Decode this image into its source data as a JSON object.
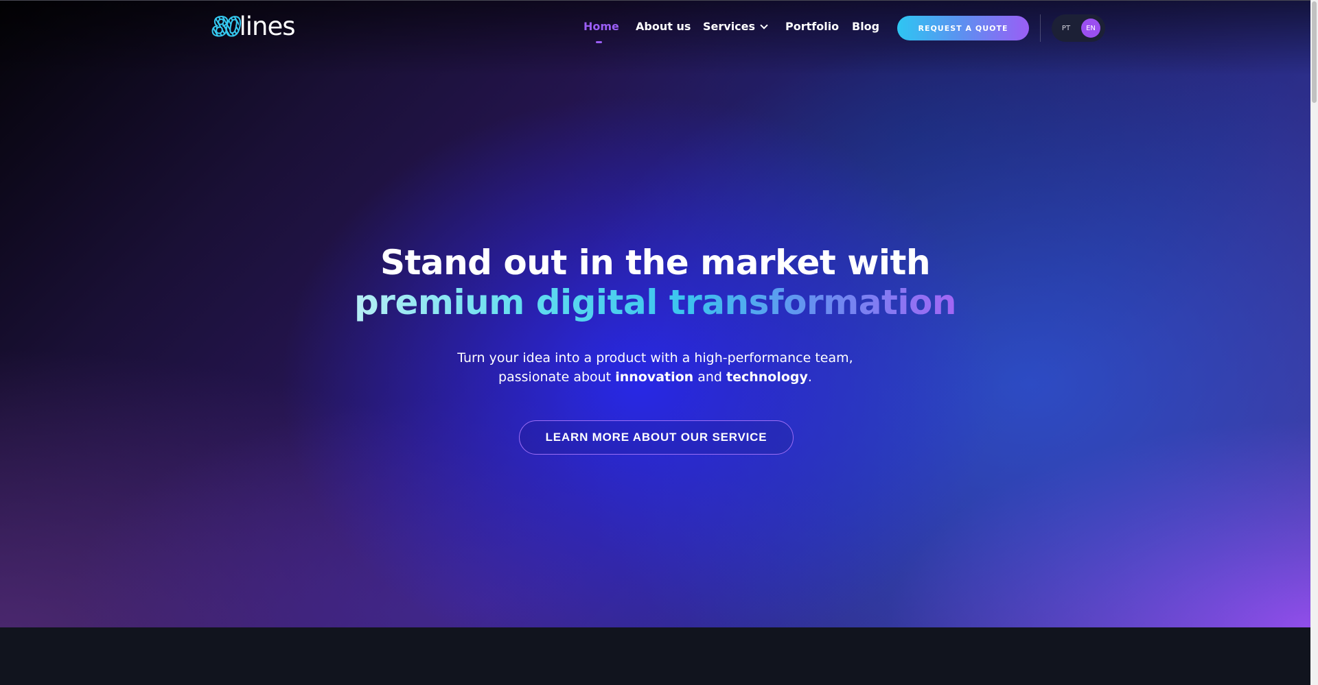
{
  "brand": {
    "logo_mark": "80",
    "logo_word": "lines"
  },
  "nav": {
    "items": [
      {
        "label": "Home",
        "active": true
      },
      {
        "label": "About us"
      },
      {
        "label": "Services",
        "has_dropdown": true
      },
      {
        "label": "Portfolio"
      },
      {
        "label": "Blog"
      }
    ],
    "cta_label": "REQUEST A QUOTE",
    "languages": [
      "PT",
      "EN"
    ],
    "selected_language": "EN"
  },
  "hero": {
    "headline_line1": "Stand out in the market with",
    "headline_line2": "premium digital transformation",
    "subtitle_line1": "Turn your idea into a product with a high-performance team,",
    "subtitle_pre": "passionate about ",
    "subtitle_bold1": "innovation",
    "subtitle_mid": " and ",
    "subtitle_bold2": "technology",
    "subtitle_end": ".",
    "cta_label": "LEARN MORE ABOUT OUR SERVICE"
  },
  "icons": {
    "dropdown": "chevron-down-icon"
  },
  "colors": {
    "accent_purple": "#9b5ef5",
    "accent_cyan": "#2ec6f2",
    "hero_blue": "#2828eb",
    "page_bg": "#11141e"
  }
}
